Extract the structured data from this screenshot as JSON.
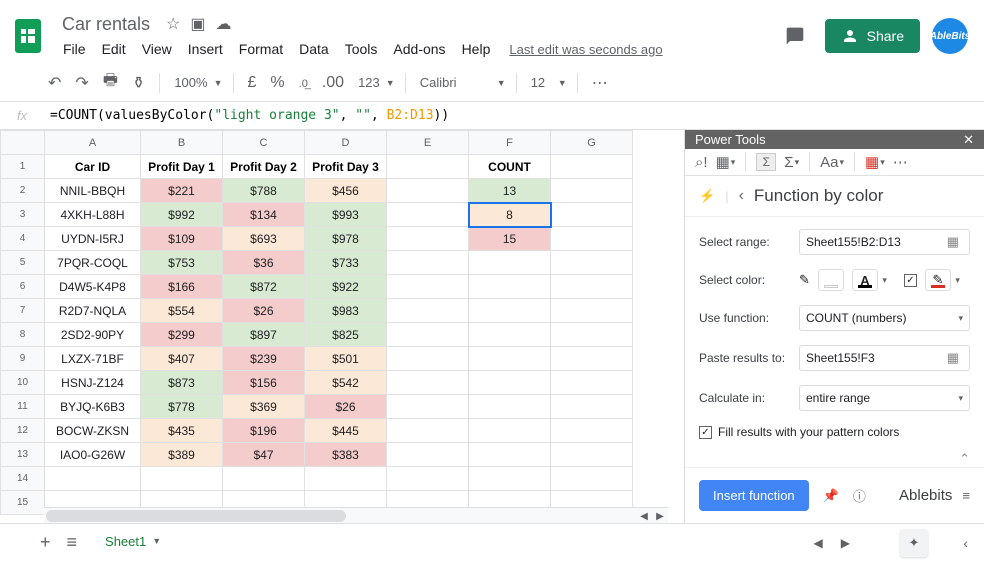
{
  "doc": {
    "title": "Car rentals",
    "last_edit": "Last edit was seconds ago"
  },
  "menu": {
    "file": "File",
    "edit": "Edit",
    "view": "View",
    "insert": "Insert",
    "format": "Format",
    "data": "Data",
    "tools": "Tools",
    "addons": "Add-ons",
    "help": "Help"
  },
  "share": {
    "label": "Share"
  },
  "avatar": {
    "label": "AbleBits"
  },
  "toolbar": {
    "zoom": "100%",
    "currency": "£",
    "percent": "%",
    "dec_dec": ".0",
    "dec_inc": ".00",
    "num_fmt": "123",
    "font": "Calibri",
    "size": "12"
  },
  "formula": {
    "prefix": "=COUNT(valuesByColor(",
    "arg1": "\"light orange 3\"",
    "sep1": ", ",
    "arg2": "\"\"",
    "sep2": ", ",
    "arg3": "B2:D13",
    "suffix": "))"
  },
  "cols": [
    "A",
    "B",
    "C",
    "D",
    "E",
    "F",
    "G"
  ],
  "headers": {
    "a": "Car ID",
    "b": "Profit Day 1",
    "c": "Profit Day 2",
    "d": "Profit Day 3",
    "f": "COUNT"
  },
  "rows": [
    {
      "a": "NNIL-BBQH",
      "b": "$221",
      "bk": "red",
      "c": "$788",
      "ck": "green",
      "d": "$456",
      "dk": "orange",
      "f": "13",
      "fk": "green"
    },
    {
      "a": "4XKH-L88H",
      "b": "$992",
      "bk": "green",
      "c": "$134",
      "ck": "red",
      "d": "$993",
      "dk": "green",
      "f": "8",
      "fk": "orange"
    },
    {
      "a": "UYDN-I5RJ",
      "b": "$109",
      "bk": "red",
      "c": "$693",
      "ck": "orange",
      "d": "$978",
      "dk": "green",
      "f": "15",
      "fk": "red"
    },
    {
      "a": "7PQR-COQL",
      "b": "$753",
      "bk": "green",
      "c": "$36",
      "ck": "red",
      "d": "$733",
      "dk": "green"
    },
    {
      "a": "D4W5-K4P8",
      "b": "$166",
      "bk": "red",
      "c": "$872",
      "ck": "green",
      "d": "$922",
      "dk": "green"
    },
    {
      "a": "R2D7-NQLA",
      "b": "$554",
      "bk": "orange",
      "c": "$26",
      "ck": "red",
      "d": "$983",
      "dk": "green"
    },
    {
      "a": "2SD2-90PY",
      "b": "$299",
      "bk": "red",
      "c": "$897",
      "ck": "green",
      "d": "$825",
      "dk": "green"
    },
    {
      "a": "LXZX-71BF",
      "b": "$407",
      "bk": "orange",
      "c": "$239",
      "ck": "red",
      "d": "$501",
      "dk": "orange"
    },
    {
      "a": "HSNJ-Z124",
      "b": "$873",
      "bk": "green",
      "c": "$156",
      "ck": "red",
      "d": "$542",
      "dk": "orange"
    },
    {
      "a": "BYJQ-K6B3",
      "b": "$778",
      "bk": "green",
      "c": "$369",
      "ck": "orange",
      "d": "$26",
      "dk": "red"
    },
    {
      "a": "BOCW-ZKSN",
      "b": "$435",
      "bk": "orange",
      "c": "$196",
      "ck": "red",
      "d": "$445",
      "dk": "orange"
    },
    {
      "a": "IAO0-G26W",
      "b": "$389",
      "bk": "orange",
      "c": "$47",
      "ck": "red",
      "d": "$383",
      "dk": "red"
    }
  ],
  "panel": {
    "header": "Power Tools",
    "title": "Function by color",
    "range_label": "Select range:",
    "range": "Sheet155!B2:D13",
    "color_label": "Select color:",
    "func_label": "Use function:",
    "func": "COUNT (numbers)",
    "paste_label": "Paste results to:",
    "paste": "Sheet155!F3",
    "calc_label": "Calculate in:",
    "calc": "entire range",
    "fill_label": "Fill results with your pattern colors",
    "insert_btn": "Insert function",
    "brand": "Ablebits"
  },
  "sheet_tab": "Sheet1"
}
